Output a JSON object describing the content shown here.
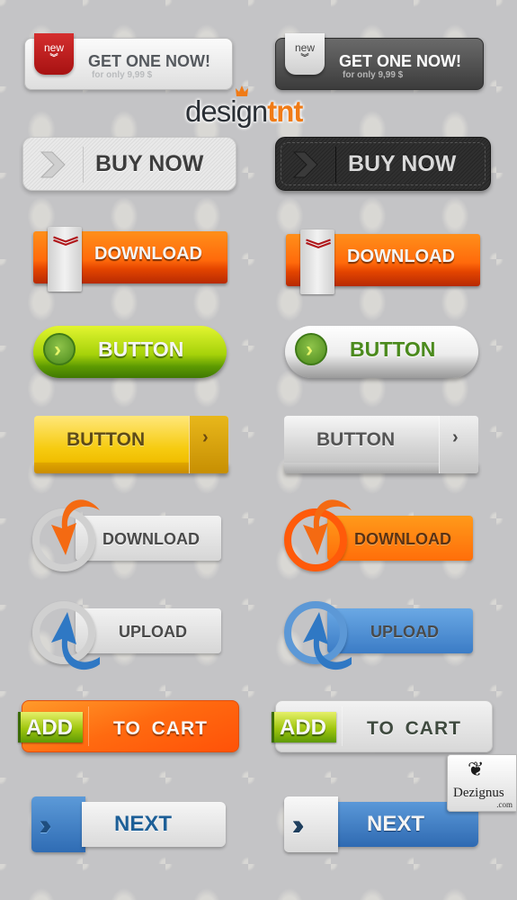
{
  "get_one_now": [
    {
      "variant": "light",
      "badge": "new",
      "badge_icon": "double-chevron-down-icon",
      "title": "GET ONE NOW!",
      "subtitle": "for only 9,99 $"
    },
    {
      "variant": "dark",
      "badge": "new",
      "badge_icon": "double-chevron-down-icon",
      "title": "GET ONE NOW!",
      "subtitle": "for only 9,99 $"
    }
  ],
  "logo": {
    "part1": "design",
    "part2": "tnt",
    "icon": "crown-icon",
    "colors": {
      "dark": "#2a2f35",
      "accent": "#f07b16"
    }
  },
  "buy_now": [
    {
      "variant": "light",
      "icon": "chevron-right-icon",
      "label": "BUY NOW"
    },
    {
      "variant": "dark",
      "icon": "chevron-right-icon",
      "label": "BUY NOW"
    }
  ],
  "download_orange": [
    {
      "icon": "double-chevron-down-icon",
      "icon_glyph": "︾",
      "label": "DOWNLOAD"
    },
    {
      "icon": "double-chevron-down-icon",
      "icon_glyph": "︾",
      "label": "DOWNLOAD"
    }
  ],
  "pill_buttons": [
    {
      "variant": "green",
      "icon": "arrow-right-circle-icon",
      "icon_glyph": "›",
      "label": "BUTTON"
    },
    {
      "variant": "white",
      "icon": "arrow-right-circle-icon",
      "icon_glyph": "›",
      "label": "BUTTON"
    }
  ],
  "block_buttons": [
    {
      "variant": "yellow",
      "label": "BUTTON",
      "icon": "chevron-right-icon",
      "icon_glyph": "›"
    },
    {
      "variant": "silver",
      "label": "BUTTON",
      "icon": "chevron-right-icon",
      "icon_glyph": "›"
    }
  ],
  "circle_buttons": [
    {
      "variant": "silver",
      "label": "DOWNLOAD",
      "icon": "curved-arrow-down-icon",
      "arrow_color": "#f46a12"
    },
    {
      "variant": "orange",
      "label": "DOWNLOAD",
      "icon": "curved-arrow-down-icon",
      "arrow_color": "#f46a12"
    },
    {
      "variant": "silver",
      "label": "UPLOAD",
      "icon": "curved-arrow-up-icon",
      "arrow_color": "#2f78c4"
    },
    {
      "variant": "blue",
      "label": "UPLOAD",
      "icon": "curved-arrow-up-icon",
      "arrow_color": "#2f78c4"
    }
  ],
  "add_to_cart": [
    {
      "variant": "orange",
      "add_label": "ADD",
      "label": "TO CART"
    },
    {
      "variant": "silver",
      "add_label": "ADD",
      "label": "TO CART"
    }
  ],
  "next_buttons": [
    {
      "variant": "blue-left",
      "icon": "double-chevron-right-icon",
      "icon_glyph": "››",
      "label": "NEXT"
    },
    {
      "variant": "blue-right",
      "icon": "double-chevron-right-icon",
      "icon_glyph": "››",
      "label": "NEXT"
    }
  ],
  "watermark": {
    "ornament": "❦",
    "name": "Dezignus",
    "domain": ".com"
  },
  "colors": {
    "background": "#c4c4c6",
    "orange": "#ff6a0b",
    "green": "#a6d20a",
    "blue": "#3b7cc6",
    "yellow": "#f6cb10",
    "red": "#c21f1f"
  }
}
